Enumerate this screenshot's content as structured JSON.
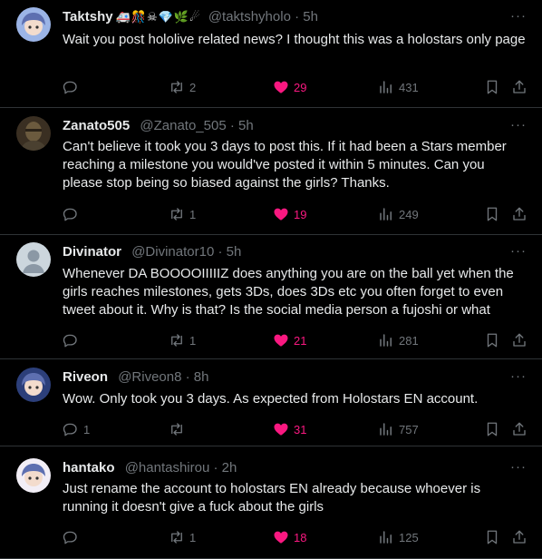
{
  "tweets": [
    {
      "name": "Taktshy",
      "emoji": "🚑🎊☠💎🌿☄",
      "handle": "@taktshyholo",
      "dot": "·",
      "time": "5h",
      "text": "Wait you post hololive related news? I thought this was a holostars only page",
      "replies": "",
      "retweets": "2",
      "likes": "29",
      "views": "431",
      "avatar_icon": "anime-avatar-icon",
      "avatar_color": "#9bb4e6"
    },
    {
      "name": "Zanato505",
      "emoji": "",
      "handle": "@Zanato_505",
      "dot": "·",
      "time": "5h",
      "text": "Can't believe it took you 3 days to post this. If it had been a Stars member reaching a milestone you would've posted it within 5 minutes. Can you please stop being so biased against the girls? Thanks.",
      "replies": "",
      "retweets": "1",
      "likes": "19",
      "views": "249",
      "avatar_icon": "photo-avatar-icon",
      "avatar_color": "#6b5a3e"
    },
    {
      "name": "Divinator",
      "emoji": "",
      "handle": "@Divinator10",
      "dot": "·",
      "time": "5h",
      "text": "Whenever DA BOOOOIIIIIZ does anything you are on the ball yet when the girls reaches milestones, gets 3Ds, does 3Ds etc you often forget to even tweet about it. Why is that? Is the social media person a fujoshi or what",
      "replies": "",
      "retweets": "1",
      "likes": "21",
      "views": "281",
      "avatar_icon": "default-avatar-icon",
      "avatar_color": "#ccd6dd"
    },
    {
      "name": "Riveon",
      "emoji": "",
      "handle": "@Riveon8",
      "dot": "·",
      "time": "8h",
      "text": "Wow. Only took you 3 days. As expected from Holostars EN account.",
      "replies": "1",
      "retweets": "",
      "likes": "31",
      "views": "757",
      "avatar_icon": "anime-avatar-icon",
      "avatar_color": "#2c3f7a"
    },
    {
      "name": "hantako",
      "emoji": "",
      "handle": "@hantashirou",
      "dot": "·",
      "time": "2h",
      "text": "Just rename the account to holostars EN already because whoever is running it doesn't give a fuck about the girls",
      "replies": "",
      "retweets": "1",
      "likes": "18",
      "views": "125",
      "avatar_icon": "anime-avatar-icon",
      "avatar_color": "#f2eef6"
    }
  ],
  "colors": {
    "background": "#000000",
    "text": "#e7e9ea",
    "muted": "#71767b",
    "like": "#f91880",
    "divider": "#2f3336"
  },
  "icons": {
    "reply": "reply-icon",
    "retweet": "retweet-icon",
    "like": "heart-icon",
    "views": "views-icon",
    "bookmark": "bookmark-icon",
    "share": "share-icon",
    "more": "more-icon"
  },
  "more_glyph": "···"
}
